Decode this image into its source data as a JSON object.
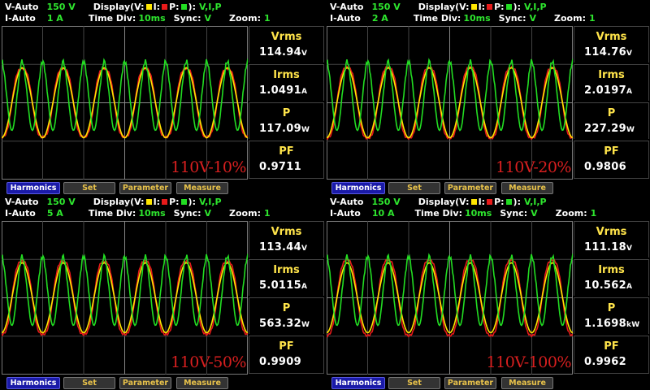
{
  "header_labels": {
    "display": "Display(",
    "v_marker": "V:",
    "i_marker": "I:",
    "p_marker": "P:",
    "close": "):",
    "display_value": "V,I,P",
    "time_div": "Time Div:",
    "time_div_value": "10ms",
    "sync": "Sync:",
    "sync_value": "V",
    "zoom": "Zoom:",
    "zoom_value": "1"
  },
  "colors": {
    "voltage": "#ffe600",
    "current": "#e81a1a",
    "power": "#22dd22",
    "accent": "#2ee62e"
  },
  "meas_labels": [
    "Vrms",
    "Irms",
    "P",
    "PF"
  ],
  "buttons": [
    "Harmonics",
    "Set",
    "Parameter",
    "Measure"
  ],
  "panels": [
    {
      "v_range_label": "V-Auto",
      "v_range": "150 V",
      "i_range_label": "I-Auto",
      "i_range": "1 A",
      "values": [
        {
          "num": "114.94",
          "unit": "V"
        },
        {
          "num": "1.0491",
          "unit": "A"
        },
        {
          "num": "117.09",
          "unit": "W"
        },
        {
          "num": "0.9711",
          "unit": ""
        }
      ],
      "watermark": "110V-10%"
    },
    {
      "v_range_label": "V-Auto",
      "v_range": "150 V",
      "i_range_label": "I-Auto",
      "i_range": "2 A",
      "values": [
        {
          "num": "114.76",
          "unit": "V"
        },
        {
          "num": "2.0197",
          "unit": "A"
        },
        {
          "num": "227.29",
          "unit": "W"
        },
        {
          "num": "0.9806",
          "unit": ""
        }
      ],
      "watermark": "110V-20%"
    },
    {
      "v_range_label": "V-Auto",
      "v_range": "150 V",
      "i_range_label": "I-Auto",
      "i_range": "5 A",
      "values": [
        {
          "num": "113.44",
          "unit": "V"
        },
        {
          "num": "5.0115",
          "unit": "A"
        },
        {
          "num": "563.32",
          "unit": "W"
        },
        {
          "num": "0.9909",
          "unit": ""
        }
      ],
      "watermark": "110V-50%"
    },
    {
      "v_range_label": "V-Auto",
      "v_range": "150 V",
      "i_range_label": "I-Auto",
      "i_range": "10 A",
      "values": [
        {
          "num": "111.18",
          "unit": "V"
        },
        {
          "num": "10.562",
          "unit": "A"
        },
        {
          "num": "1.1698",
          "unit": "kW"
        },
        {
          "num": "0.9962",
          "unit": ""
        }
      ],
      "watermark": "110V-100%"
    }
  ]
}
